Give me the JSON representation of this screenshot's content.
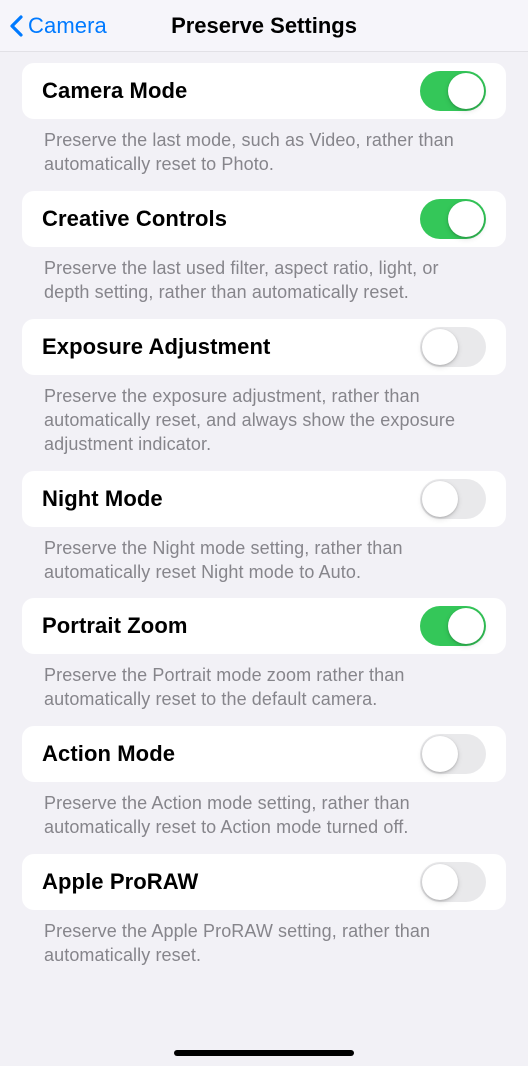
{
  "nav": {
    "back_label": "Camera",
    "title": "Preserve Settings"
  },
  "settings": [
    {
      "id": "camera-mode",
      "label": "Camera Mode",
      "description": "Preserve the last mode, such as Video, rather than automatically reset to Photo.",
      "enabled": true
    },
    {
      "id": "creative-controls",
      "label": "Creative Controls",
      "description": "Preserve the last used filter, aspect ratio, light, or depth setting, rather than automatically reset.",
      "enabled": true
    },
    {
      "id": "exposure-adjustment",
      "label": "Exposure Adjustment",
      "description": "Preserve the exposure adjustment, rather than automatically reset, and always show the exposure adjustment indicator.",
      "enabled": false
    },
    {
      "id": "night-mode",
      "label": "Night Mode",
      "description": "Preserve the Night mode setting, rather than automatically reset Night mode to Auto.",
      "enabled": false
    },
    {
      "id": "portrait-zoom",
      "label": "Portrait Zoom",
      "description": "Preserve the Portrait mode zoom rather than automatically reset to the default camera.",
      "enabled": true
    },
    {
      "id": "action-mode",
      "label": "Action Mode",
      "description": "Preserve the Action mode setting, rather than automatically reset to Action mode turned off.",
      "enabled": false
    },
    {
      "id": "apple-proraw",
      "label": "Apple ProRAW",
      "description": "Preserve the Apple ProRAW setting, rather than automatically reset.",
      "enabled": false
    }
  ]
}
